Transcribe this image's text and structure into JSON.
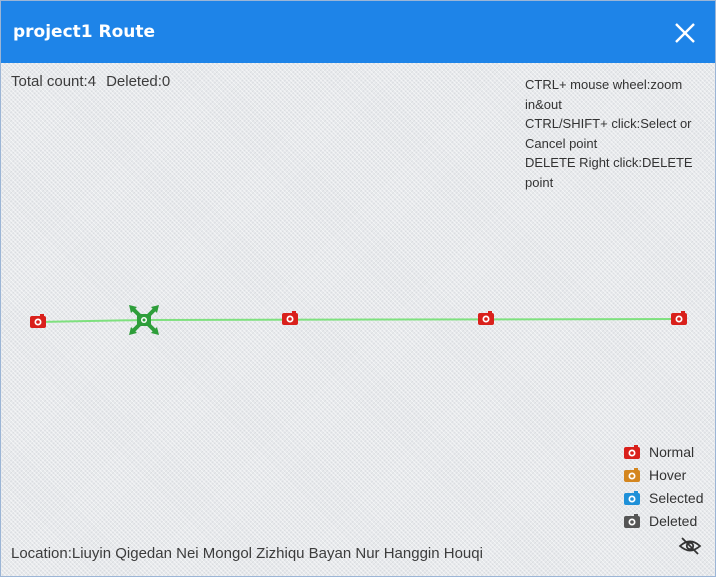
{
  "dialog": {
    "title": "project1 Route",
    "close_icon": "close-icon"
  },
  "stats": {
    "total": "Total count:4",
    "deleted": "Deleted:0"
  },
  "help": {
    "line1": "CTRL+ mouse wheel:zoom in&out",
    "line2": "CTRL/SHIFT+ click:Select or Cancel point",
    "line3": "DELETE Right click:DELETE point"
  },
  "route": {
    "line_color": "#7ee07e",
    "points": [
      {
        "state": "normal",
        "icon": "camera-icon"
      },
      {
        "state": "selected-drag",
        "icon": "move-handle-icon"
      },
      {
        "state": "normal",
        "icon": "camera-icon"
      },
      {
        "state": "normal",
        "icon": "camera-icon"
      },
      {
        "state": "normal",
        "icon": "camera-icon"
      }
    ]
  },
  "legend": {
    "items": [
      {
        "label": "Normal",
        "color": "#d9201b",
        "icon": "camera-icon"
      },
      {
        "label": "Hover",
        "color": "#d4861f",
        "icon": "camera-icon"
      },
      {
        "label": "Selected",
        "color": "#1e90d8",
        "icon": "camera-icon"
      },
      {
        "label": "Deleted",
        "color": "#555555",
        "icon": "camera-icon"
      }
    ]
  },
  "location": {
    "text": "Location:Liuyin Qigedan Nei Mongol Zizhiqu Bayan Nur Hanggin Houqi"
  },
  "colors": {
    "titlebar": "#1e84e8",
    "handle": "#2e9e3a"
  },
  "toggle": {
    "icon": "eye-off-icon"
  }
}
